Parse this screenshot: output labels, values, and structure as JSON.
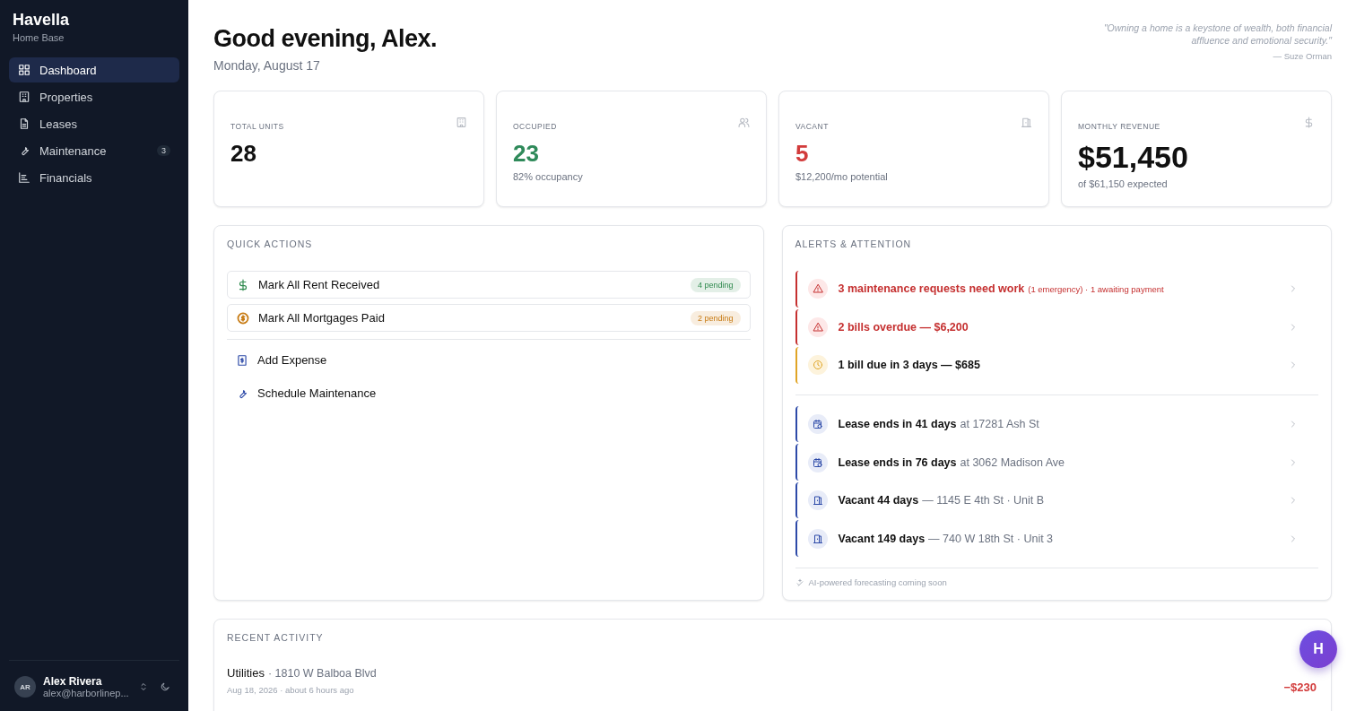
{
  "sidebar": {
    "brand": "Havella",
    "subtitle": "Home Base",
    "items": [
      {
        "label": "Dashboard",
        "selected": true
      },
      {
        "label": "Properties",
        "selected": false
      },
      {
        "label": "Leases",
        "selected": false
      },
      {
        "label": "Maintenance",
        "selected": false,
        "badge": "3"
      },
      {
        "label": "Financials",
        "selected": false
      }
    ],
    "user": {
      "initials": "AR",
      "name": "Alex Rivera",
      "email": "alex@harborlinep..."
    }
  },
  "header": {
    "greeting": "Good evening, Alex.",
    "date": "Monday, August 17",
    "quote": "\"Owning a home is a keystone of wealth, both financial affluence and emotional security.\"",
    "author": "— Suze Orman"
  },
  "stats": [
    {
      "label": "TOTAL UNITS",
      "value": "28",
      "color": "#111111"
    },
    {
      "label": "OCCUPIED",
      "value": "23",
      "color": "#2f8a5a",
      "sub": "82% occupancy"
    },
    {
      "label": "VACANT",
      "value": "5",
      "color": "#d23b3b",
      "sub": "$12,200/mo potential"
    },
    {
      "label": "MONTHLY REVENUE",
      "value": "$51,450",
      "color": "#111111",
      "sub": "of $61,150 expected"
    }
  ],
  "quick_actions": {
    "title": "QUICK ACTIONS",
    "primary": [
      {
        "label": "Mark All Rent Received",
        "badge": "4 pending",
        "color": "#2f8a4e"
      },
      {
        "label": "Mark All Mortgages Paid",
        "badge": "2 pending",
        "color": "#c77a12"
      }
    ],
    "secondary": [
      {
        "label": "Add Expense"
      },
      {
        "label": "Schedule Maintenance"
      }
    ]
  },
  "alerts": {
    "title": "ALERTS & ATTENTION",
    "groups": [
      [
        {
          "kind": "danger",
          "title": "3 maintenance requests need work",
          "detail": "(1 emergency) · 1 awaiting payment"
        },
        {
          "kind": "danger",
          "title": "2 bills overdue — $6,200"
        },
        {
          "kind": "warning",
          "title": "1 bill due in 3 days — $685"
        }
      ],
      [
        {
          "kind": "lease",
          "title": "Lease ends in 41 days",
          "detail": "at 17281 Ash St"
        },
        {
          "kind": "lease",
          "title": "Lease ends in 76 days",
          "detail": "at 3062 Madison Ave"
        },
        {
          "kind": "vacant",
          "title": "Vacant 44 days",
          "detail": "— 1145 E 4th St · Unit B"
        },
        {
          "kind": "vacant",
          "title": "Vacant 149 days",
          "detail": "— 740 W 18th St · Unit 3"
        }
      ]
    ],
    "footer": "AI-powered forecasting coming soon"
  },
  "activity": {
    "title": "RECENT ACTIVITY",
    "items": [
      {
        "category": "Utilities",
        "place": "· 1810 W Balboa Blvd",
        "meta": "Aug 18, 2026 · about 6 hours ago",
        "amount": "−$230"
      }
    ]
  },
  "assistant": {
    "label": "H"
  }
}
